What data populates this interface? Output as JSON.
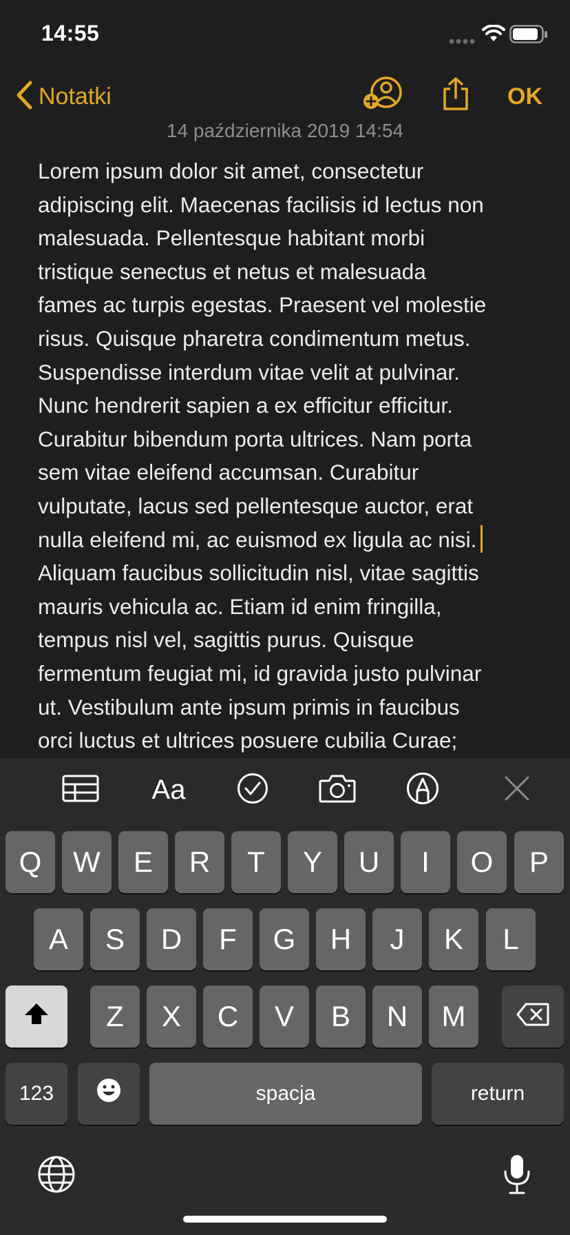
{
  "status_bar": {
    "time": "14:55"
  },
  "nav": {
    "back_label": "Notatki",
    "ok_label": "OK",
    "accent_color": "#e3a823"
  },
  "note": {
    "date": "14 października 2019 14:54",
    "lines": [
      "Lorem ipsum dolor sit amet, consectetur",
      "adipiscing elit. Maecenas facilisis id lectus non",
      "malesuada. Pellentesque habitant morbi",
      "tristique senectus et netus et malesuada",
      "fames ac turpis egestas. Praesent vel molestie",
      "risus. Quisque pharetra condimentum metus.",
      "Suspendisse interdum vitae velit at pulvinar.",
      "Nunc hendrerit sapien a ex efficitur efficitur.",
      "Curabitur bibendum porta ultrices. Nam porta",
      "sem vitae eleifend accumsan. Curabitur",
      "vulputate, lacus sed pellentesque auctor, erat",
      "nulla eleifend mi, ac euismod ex ligula ac nisi.",
      "Aliquam faucibus sollicitudin nisl, vitae sagittis",
      "mauris vehicula ac. Etiam id enim fringilla,",
      "tempus nisl vel, sagittis purus. Quisque",
      "fermentum feugiat mi, id gravida justo pulvinar",
      "ut. Vestibulum ante ipsum primis in faucibus",
      "orci luctus et ultrices posuere cubilia Curae;"
    ]
  },
  "toolbar": {
    "format_label": "Aa",
    "icons": [
      "table-icon",
      "format-text-icon",
      "checklist-icon",
      "camera-icon",
      "markup-pen-icon",
      "close-icon"
    ]
  },
  "keyboard": {
    "row1": [
      "Q",
      "W",
      "E",
      "R",
      "T",
      "Y",
      "U",
      "I",
      "O",
      "P"
    ],
    "row2": [
      "A",
      "S",
      "D",
      "F",
      "G",
      "H",
      "J",
      "K",
      "L"
    ],
    "row3": [
      "Z",
      "X",
      "C",
      "V",
      "B",
      "N",
      "M"
    ],
    "numbers_label": "123",
    "space_label": "spacja",
    "return_label": "return"
  }
}
